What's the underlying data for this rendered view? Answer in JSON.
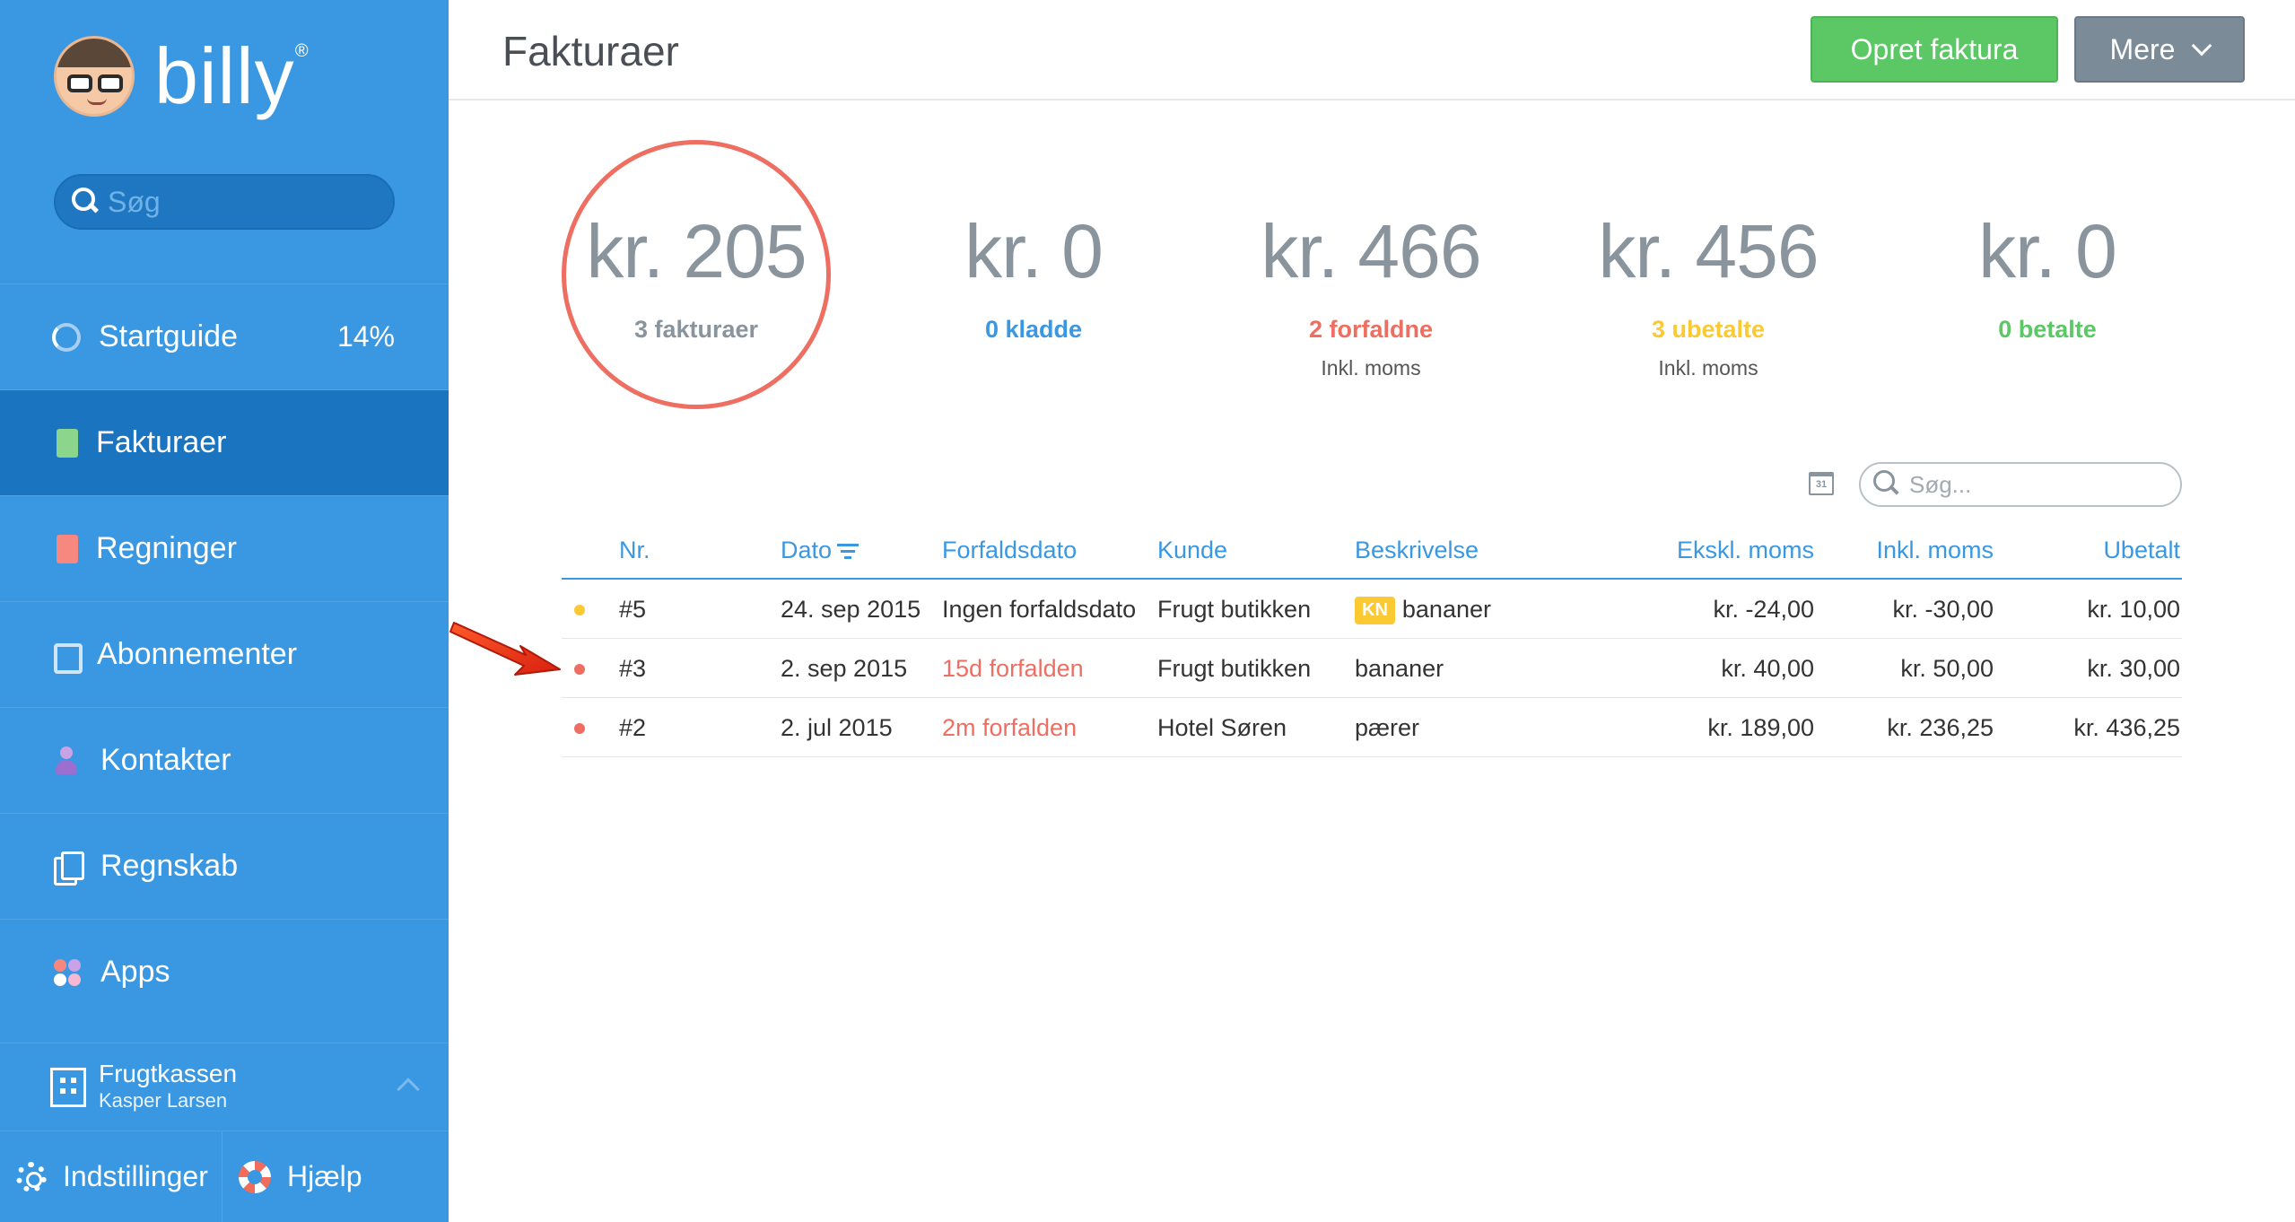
{
  "logo": {
    "text": "billy",
    "mark": "®"
  },
  "sidebar": {
    "search_placeholder": "Søg",
    "items": [
      {
        "label": "Startguide",
        "icon": "spinner-icon",
        "extra": "14%"
      },
      {
        "label": "Fakturaer",
        "icon": "invoice-icon",
        "active": true
      },
      {
        "label": "Regninger",
        "icon": "bill-icon"
      },
      {
        "label": "Abonnementer",
        "icon": "subscription-icon"
      },
      {
        "label": "Kontakter",
        "icon": "contact-icon"
      },
      {
        "label": "Regnskab",
        "icon": "accounting-icon"
      },
      {
        "label": "Apps",
        "icon": "apps-icon"
      }
    ],
    "company": {
      "name": "Frugtkassen",
      "user": "Kasper Larsen"
    },
    "settings_label": "Indstillinger",
    "help_label": "Hjælp"
  },
  "header": {
    "title": "Fakturaer",
    "create_button": "Opret faktura",
    "more_button": "Mere"
  },
  "stats": [
    {
      "amount": "kr. 205",
      "label": "3 fakturaer",
      "sub": "",
      "color": "#8a949d"
    },
    {
      "amount": "kr. 0",
      "label": "0 kladde",
      "sub": "",
      "color": "#3a98e2"
    },
    {
      "amount": "kr. 466",
      "label": "2 forfaldne",
      "sub": "Inkl. moms",
      "color": "#ee6e62"
    },
    {
      "amount": "kr. 456",
      "label": "3 ubetalte",
      "sub": "Inkl. moms",
      "color": "#fbc932"
    },
    {
      "amount": "kr. 0",
      "label": "0 betalte",
      "sub": "",
      "color": "#5bc865"
    }
  ],
  "table": {
    "calendar_day": "31",
    "search_placeholder": "Søg...",
    "columns": [
      "Nr.",
      "Dato",
      "Forfaldsdato",
      "Kunde",
      "Beskrivelse",
      "Ekskl. moms",
      "Inkl. moms",
      "Ubetalt"
    ],
    "rows": [
      {
        "status_color": "#fbc932",
        "nr": "#5",
        "dato": "24. sep 2015",
        "forfald": "Ingen forfaldsdato",
        "overdue": false,
        "kunde": "Frugt butikken",
        "badge": "KN",
        "beskrivelse": "bananer",
        "ekskl": "kr. -24,00",
        "inkl": "kr. -30,00",
        "ubetalt": "kr. 10,00"
      },
      {
        "status_color": "#ee6e62",
        "nr": "#3",
        "dato": "2. sep 2015",
        "forfald": "15d forfalden",
        "overdue": true,
        "kunde": "Frugt butikken",
        "badge": "",
        "beskrivelse": "bananer",
        "ekskl": "kr. 40,00",
        "inkl": "kr. 50,00",
        "ubetalt": "kr. 30,00"
      },
      {
        "status_color": "#ee6e62",
        "nr": "#2",
        "dato": "2. jul 2015",
        "forfald": "2m forfalden",
        "overdue": true,
        "kunde": "Hotel Søren",
        "badge": "",
        "beskrivelse": "pærer",
        "ekskl": "kr. 189,00",
        "inkl": "kr. 236,25",
        "ubetalt": "kr. 436,25"
      }
    ]
  },
  "colors": {
    "sidebar": "#3a98e2",
    "sidebar_active": "#1a74c0",
    "accent": "#3a98e2",
    "overdue": "#ee6e62",
    "unpaid": "#fbc932",
    "paid": "#5bc865",
    "create_button": "#5bc865",
    "more_button": "#7c8b98"
  }
}
